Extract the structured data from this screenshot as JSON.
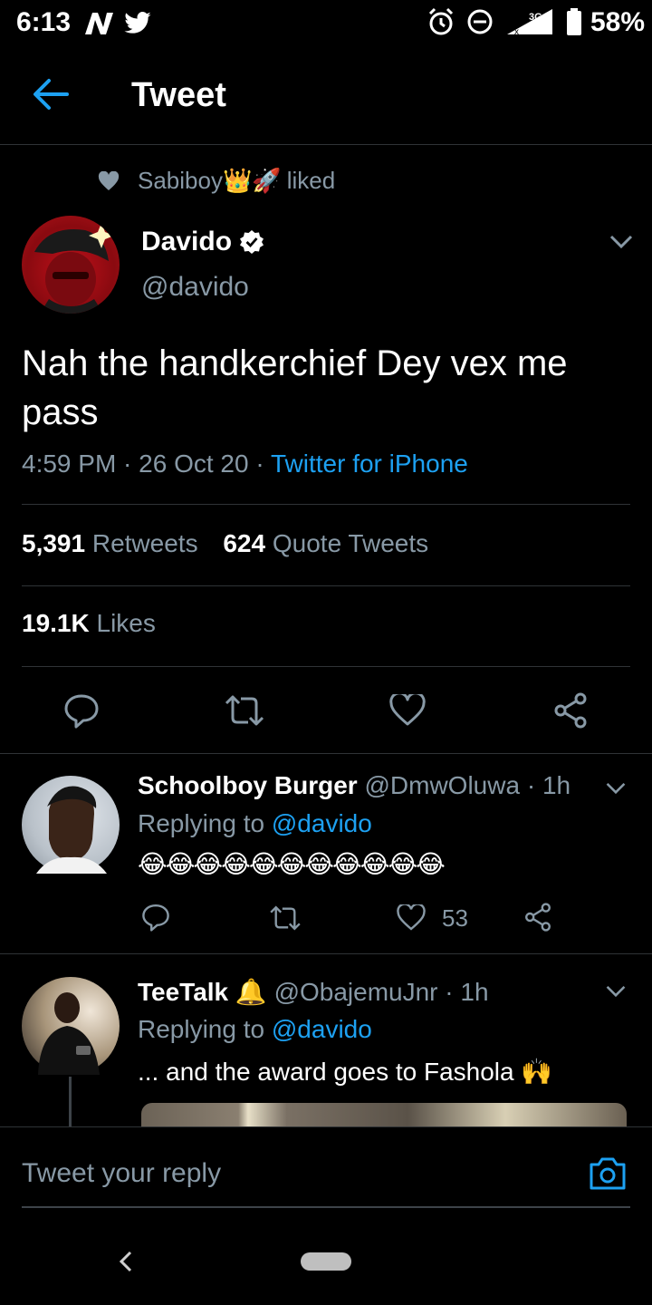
{
  "status_bar": {
    "time": "6:13",
    "network": "3G",
    "battery": "58%",
    "icons": [
      "n-app-icon",
      "twitter-bird-icon",
      "alarm-icon",
      "do-not-disturb-icon",
      "signal-3g-icon",
      "battery-icon"
    ]
  },
  "header": {
    "title": "Tweet"
  },
  "tweet": {
    "social_context_user": "Sabiboy👑🚀",
    "social_context_action": "liked",
    "author_name": "Davido",
    "author_handle": "@davido",
    "text": "Nah the handkerchief Dey vex me pass",
    "time": "4:59 PM",
    "date": "26 Oct 20",
    "separator": " · ",
    "source": "Twitter for iPhone",
    "retweets_count": "5,391",
    "retweets_label": "Retweets",
    "quotes_count": "624",
    "quotes_label": "Quote Tweets",
    "likes_count": "19.1K",
    "likes_label": "Likes"
  },
  "replies": [
    {
      "name": "Schoolboy Burger",
      "handle": "@DmwOluwa",
      "time": "1h",
      "replying_prefix": "Replying to",
      "replying_to": "@davido",
      "text": "😂😂😂😂😂😂😂😂😂😂😂",
      "like_count": "53"
    },
    {
      "name": "TeeTalk",
      "name_emoji": "🔔",
      "handle": "@ObajemuJnr",
      "time": "1h",
      "replying_prefix": "Replying to",
      "replying_to": "@davido",
      "text": "... and the award goes to Fashola 🙌"
    }
  ],
  "reply_bar": {
    "placeholder": "Tweet your reply"
  },
  "colors": {
    "background": "#000000",
    "accent": "#1da1f2",
    "muted": "#8899a6",
    "divider": "#2f3336"
  }
}
